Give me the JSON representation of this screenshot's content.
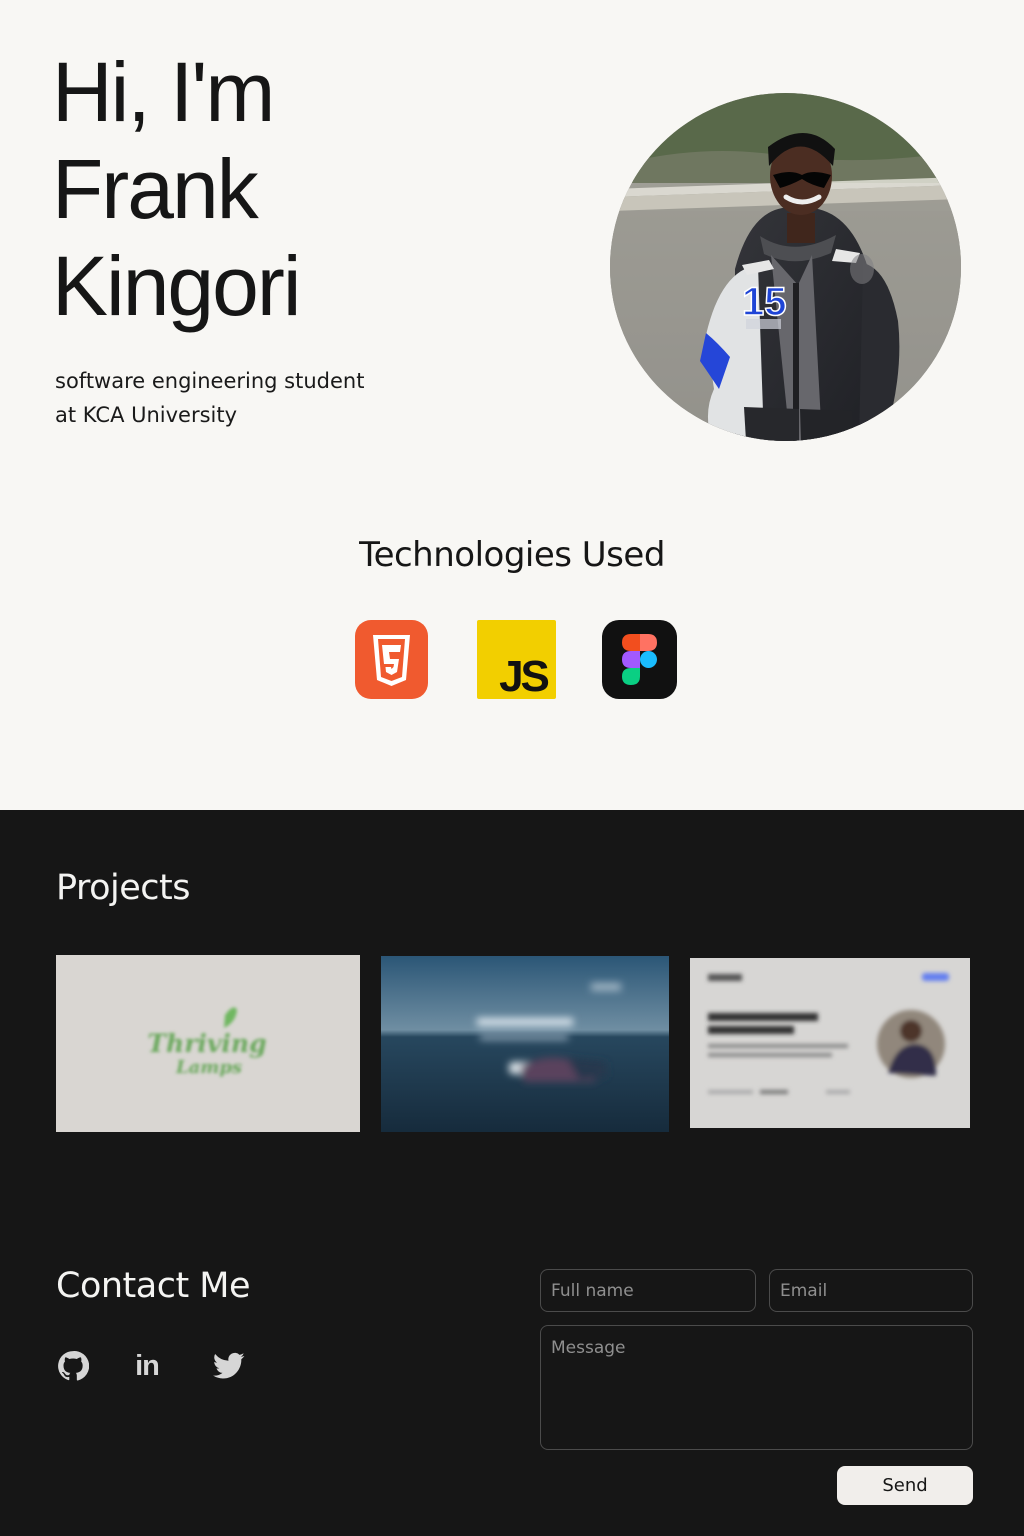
{
  "hero": {
    "title_lines": [
      "Hi, I'm",
      "Frank",
      "Kingori"
    ],
    "subtitle_lines": [
      "software engineering student",
      "at KCA University"
    ],
    "avatar_icon": "portrait-photo"
  },
  "technologies": {
    "heading": "Technologies Used",
    "items": [
      {
        "icon": "html5-icon",
        "color": "#f05a2f"
      },
      {
        "icon": "javascript-icon",
        "label": "JS",
        "color": "#f2cf00"
      },
      {
        "icon": "figma-icon",
        "color": "#111111"
      }
    ]
  },
  "projects": {
    "heading": "Projects",
    "items": [
      {
        "thumbnail": "thriving-lamps",
        "logo_text": [
          "Thriving",
          "Lamps"
        ],
        "background": "#d9d6d2"
      },
      {
        "thumbnail": "ocean-landing-page",
        "background": "#2f4c63"
      },
      {
        "thumbnail": "portfolio-landing-page",
        "background": "#d7d6d4"
      }
    ]
  },
  "contact": {
    "heading": "Contact Me",
    "socials": [
      {
        "icon": "github-icon"
      },
      {
        "icon": "linkedin-icon",
        "label": "in"
      },
      {
        "icon": "twitter-icon"
      }
    ],
    "form": {
      "name_placeholder": "Full name",
      "email_placeholder": "Email",
      "message_placeholder": "Message",
      "send_label": "Send"
    }
  },
  "colors": {
    "light_background": "#f8f7f4",
    "dark_background": "#161616",
    "text_dark": "#161616",
    "text_light": "#f4f4f2",
    "field_border": "#4b4b4b",
    "button_background": "#f1eeeb"
  }
}
